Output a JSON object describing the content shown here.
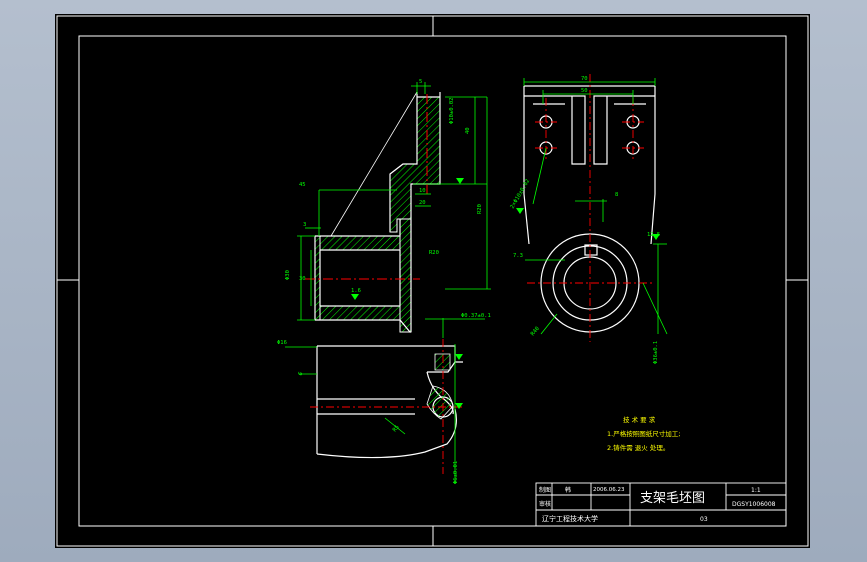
{
  "colors": {
    "background": "#000000",
    "border": "#ffffff",
    "outline": "#ffffff",
    "dimension": "#00ff00",
    "hatch": "#00ff00",
    "centerline": "#ff0000",
    "tech_text": "#ffff00",
    "viewport": "#a8b4c4"
  },
  "dimensions": {
    "side_top_width": "5",
    "side_bore_dia": "Φ10±0.02",
    "side_height": "40",
    "side_offset": "45",
    "side_wall": "3",
    "side_mid": "10",
    "side_step": "20",
    "side_rise": "R20",
    "side_left_dia": "Φ30",
    "side_inner": "30",
    "side_surface": "1.6",
    "front_total_width": "70",
    "front_inner_width": "50",
    "front_holes": "2×Φ10±0.02",
    "front_slot": "8",
    "front_roughness": "12.5",
    "front_offset": "7.3",
    "front_radius": "R40",
    "front_bottom": "Φ36±0.1",
    "top_tolerance": "Φ0.37±0.1",
    "top_left": "Φ16",
    "top_flat": "6",
    "top_r": "R5",
    "top_bottom": "Φ6±0.01"
  },
  "technical_requirements": {
    "title": "技 术 要 求",
    "line1": "1.严格按照图纸尺寸加工;",
    "line2": "2.铸件需 退火 处理。"
  },
  "title_block": {
    "drawing_title": "支架毛坯图",
    "scale": "1:1",
    "drawing_number": "DGSY1006008",
    "designer_label": "制图",
    "designer_name": "韩",
    "reviewer_label": "审核",
    "date": "2006.06.23",
    "school": "辽宁工程技术大学",
    "material": "03"
  }
}
